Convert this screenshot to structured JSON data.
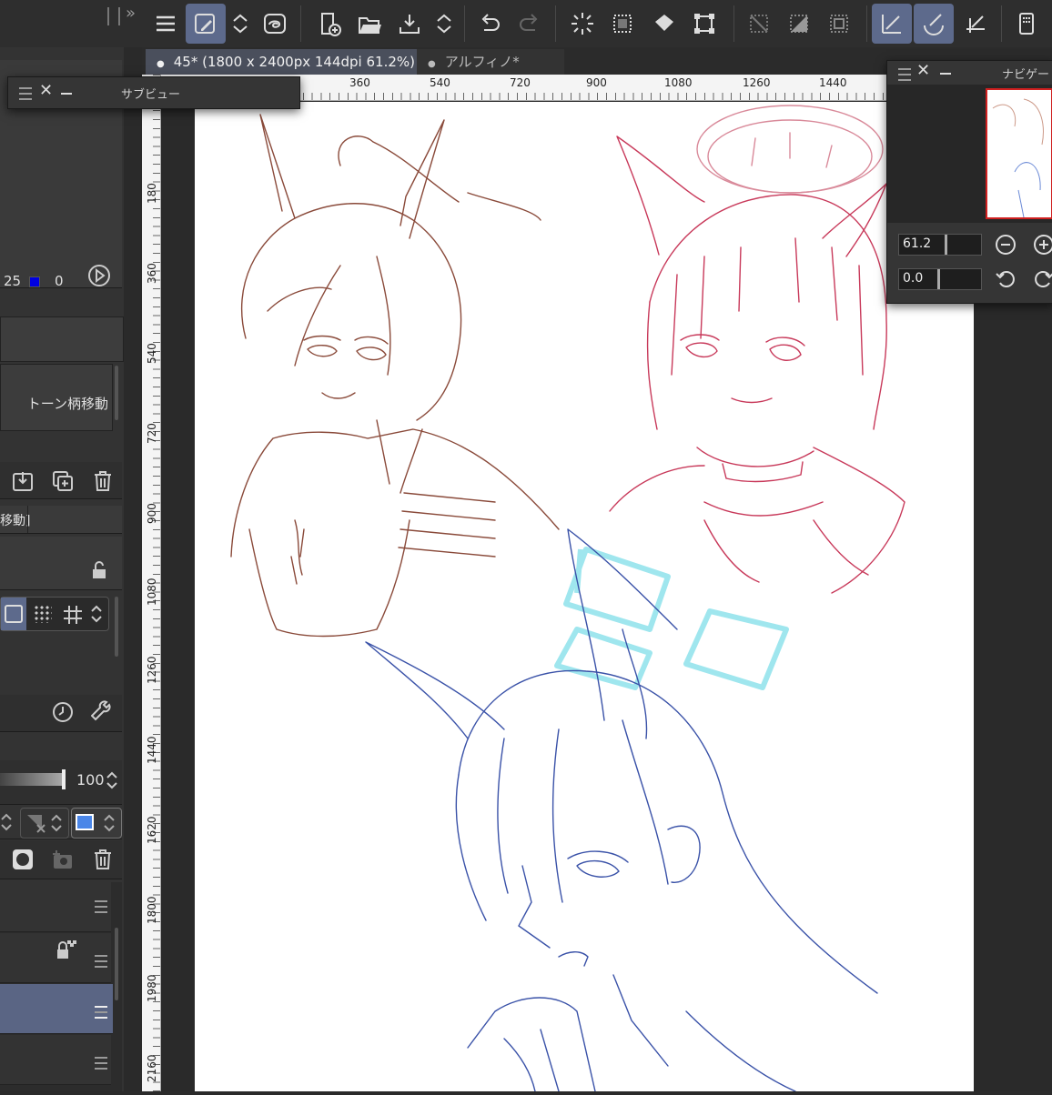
{
  "document_tabs": [
    {
      "label": "45* (1800 x 2400px 144dpi 61.2%)",
      "active": true
    },
    {
      "label": "アルフィノ*",
      "active": false
    }
  ],
  "subview_palette": {
    "title": "サブビュー"
  },
  "navigator_palette": {
    "title": "ナビゲー",
    "zoom_value": "61.2",
    "rotation_value": "0.0"
  },
  "left_panel": {
    "color_value_a": "25",
    "color_value_b": "0",
    "tone_move_label": "トーン柄移動",
    "move_bracket_label": "移動]",
    "opacity_value": "100"
  },
  "ruler": {
    "horizontal_ticks": [
      "360",
      "540",
      "720",
      "900",
      "1080",
      "1260",
      "1440"
    ],
    "vertical_ticks": [
      "180",
      "360",
      "540",
      "720",
      "900",
      "1080",
      "1260",
      "1440",
      "1620",
      "1800",
      "1980",
      "2160"
    ]
  },
  "colors": {
    "accent": "#5d6a8c",
    "sketch_brown": "#8a4a3a",
    "sketch_red": "#c8395a",
    "sketch_blue": "#3a52a8",
    "halo_cyan": "#9fe6ee"
  }
}
